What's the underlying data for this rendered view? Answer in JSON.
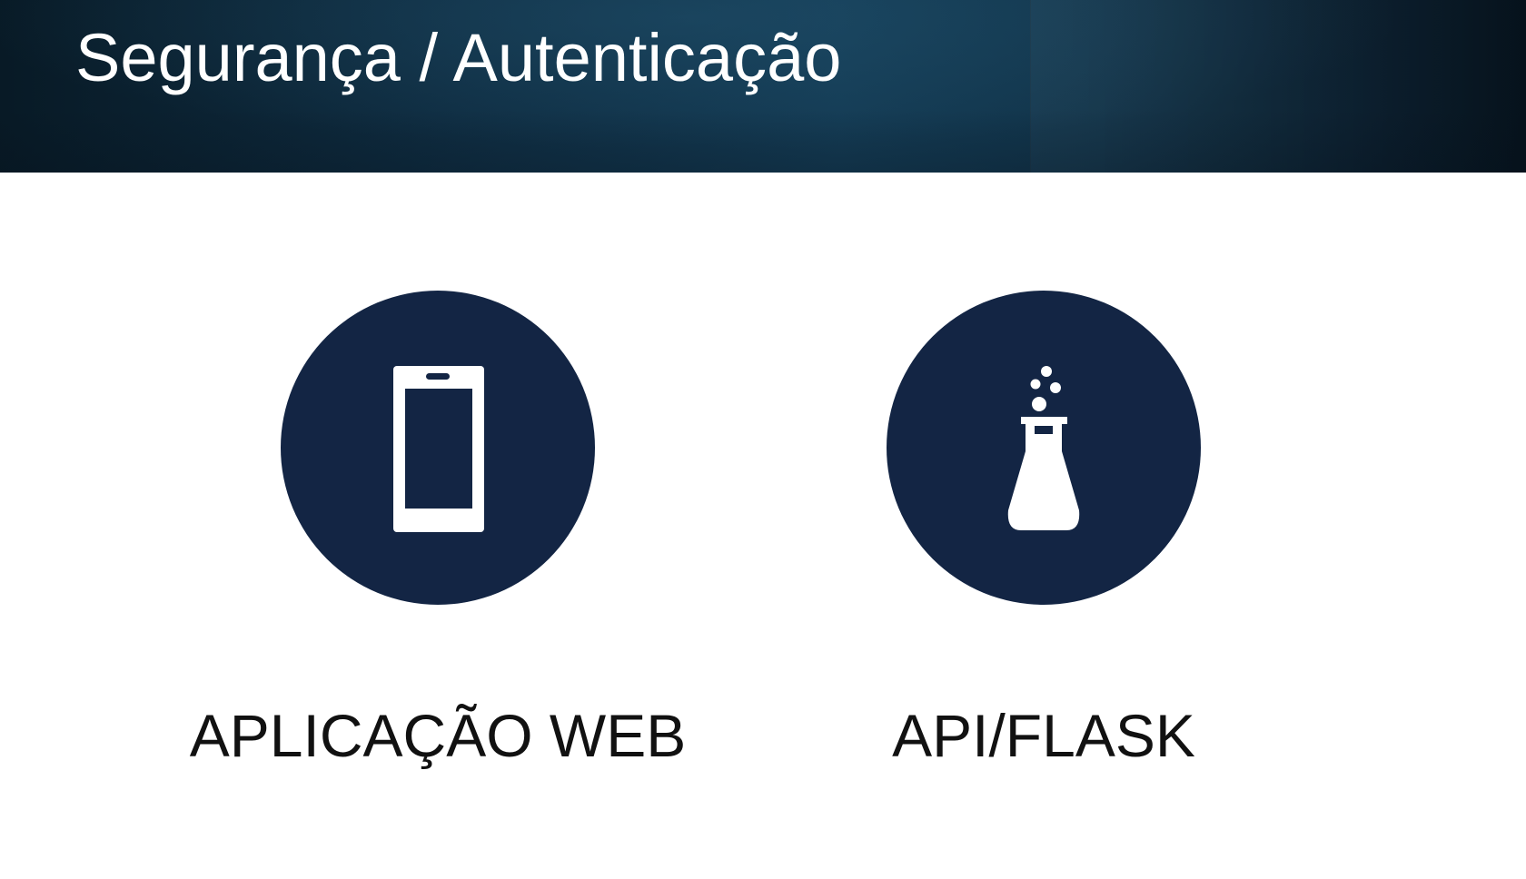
{
  "slide": {
    "title": "Segurança / Autenticação",
    "header_color": "#0f2d42",
    "circle_color": "#132544",
    "items": [
      {
        "label": "APLICAÇÃO WEB",
        "icon": "mobile-phone-icon"
      },
      {
        "label": "API/FLASK",
        "icon": "flask-icon"
      }
    ]
  }
}
